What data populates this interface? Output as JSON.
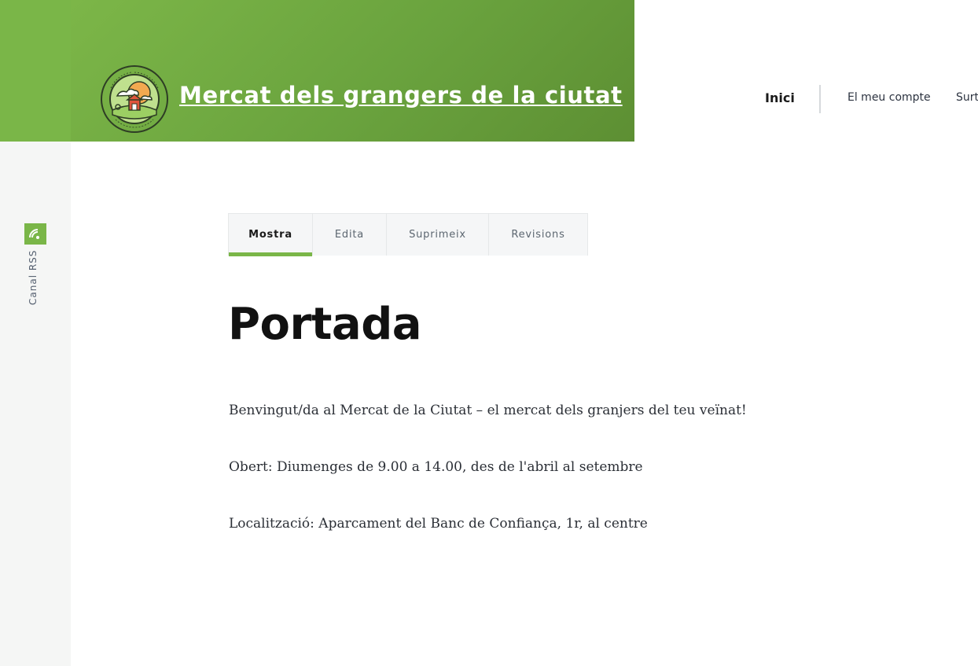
{
  "site": {
    "name": "Mercat dels grangers de la ciutat",
    "logo_top_text": "ANYTOWN FARMERS MARKET",
    "logo_bottom_text": "FARM FRESH FOOD"
  },
  "nav": {
    "home": "Inici",
    "account": "El meu compte",
    "logout": "Surt"
  },
  "sidebar": {
    "rss_label": "Canal RSS"
  },
  "tabs": [
    {
      "label": "Mostra",
      "active": true
    },
    {
      "label": "Edita"
    },
    {
      "label": "Suprimeix"
    },
    {
      "label": "Revisions"
    }
  ],
  "page": {
    "title": "Portada",
    "paragraphs": [
      "Benvingut/da al Mercat de la Ciutat – el mercat dels granjers del teu veïnat!",
      "Obert: Diumenges de 9.00 a 14.00, des de l'abril al setembre",
      "Localització: Aparcament del Banc de Confiança, 1r, al centre"
    ]
  },
  "colors": {
    "brand_green": "#7ab648",
    "header_dark_green": "#5d8f33",
    "rail_gray": "#f5f6f5"
  }
}
